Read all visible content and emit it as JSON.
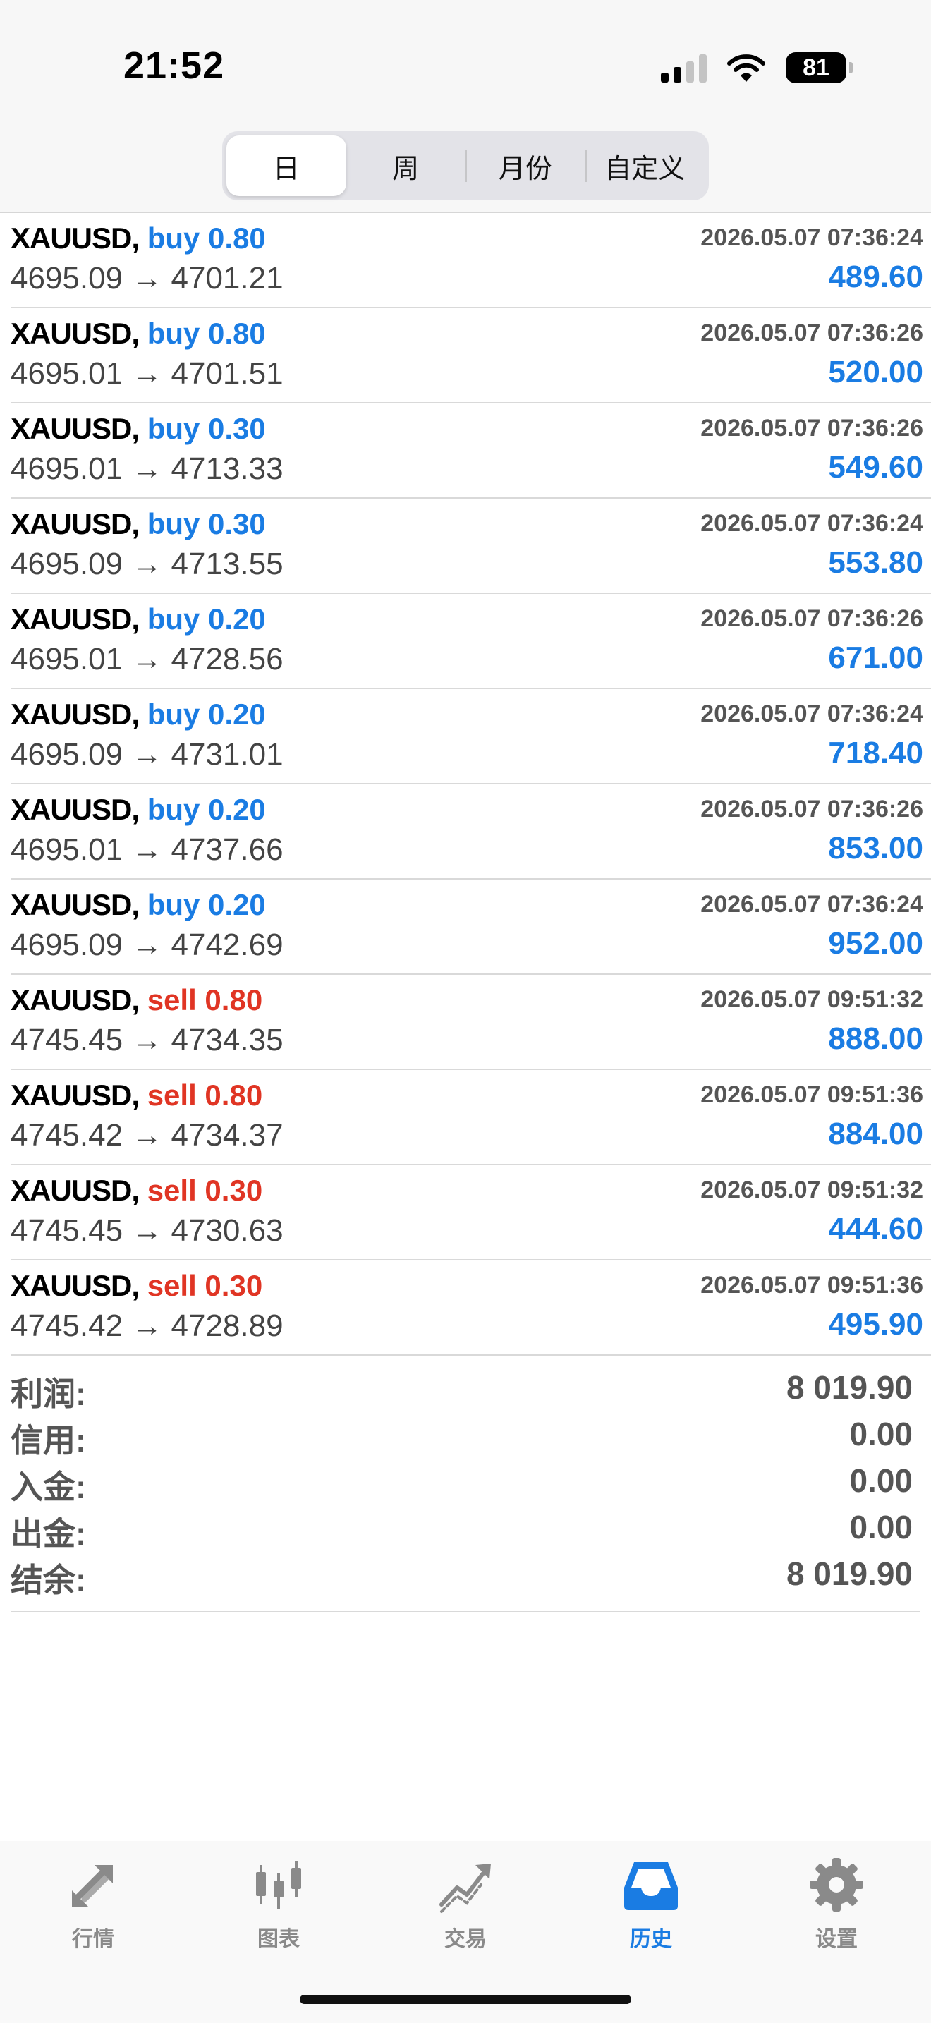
{
  "status_bar": {
    "time": "21:52",
    "battery": "81"
  },
  "period_tabs": [
    {
      "label": "日",
      "active": true
    },
    {
      "label": "周",
      "active": false
    },
    {
      "label": "月份",
      "active": false
    },
    {
      "label": "自定义",
      "active": false
    }
  ],
  "trades": [
    {
      "symbol": "XAUUSD,",
      "side": "buy",
      "side_label": "buy 0.80",
      "prices": "4695.09 → 4701.21",
      "datetime": "2026.05.07 07:36:24",
      "profit": "489.60"
    },
    {
      "symbol": "XAUUSD,",
      "side": "buy",
      "side_label": "buy 0.80",
      "prices": "4695.01 → 4701.51",
      "datetime": "2026.05.07 07:36:26",
      "profit": "520.00"
    },
    {
      "symbol": "XAUUSD,",
      "side": "buy",
      "side_label": "buy 0.30",
      "prices": "4695.01 → 4713.33",
      "datetime": "2026.05.07 07:36:26",
      "profit": "549.60"
    },
    {
      "symbol": "XAUUSD,",
      "side": "buy",
      "side_label": "buy 0.30",
      "prices": "4695.09 → 4713.55",
      "datetime": "2026.05.07 07:36:24",
      "profit": "553.80"
    },
    {
      "symbol": "XAUUSD,",
      "side": "buy",
      "side_label": "buy 0.20",
      "prices": "4695.01 → 4728.56",
      "datetime": "2026.05.07 07:36:26",
      "profit": "671.00"
    },
    {
      "symbol": "XAUUSD,",
      "side": "buy",
      "side_label": "buy 0.20",
      "prices": "4695.09 → 4731.01",
      "datetime": "2026.05.07 07:36:24",
      "profit": "718.40"
    },
    {
      "symbol": "XAUUSD,",
      "side": "buy",
      "side_label": "buy 0.20",
      "prices": "4695.01 → 4737.66",
      "datetime": "2026.05.07 07:36:26",
      "profit": "853.00"
    },
    {
      "symbol": "XAUUSD,",
      "side": "buy",
      "side_label": "buy 0.20",
      "prices": "4695.09 → 4742.69",
      "datetime": "2026.05.07 07:36:24",
      "profit": "952.00"
    },
    {
      "symbol": "XAUUSD,",
      "side": "sell",
      "side_label": "sell 0.80",
      "prices": "4745.45 → 4734.35",
      "datetime": "2026.05.07 09:51:32",
      "profit": "888.00"
    },
    {
      "symbol": "XAUUSD,",
      "side": "sell",
      "side_label": "sell 0.80",
      "prices": "4745.42 → 4734.37",
      "datetime": "2026.05.07 09:51:36",
      "profit": "884.00"
    },
    {
      "symbol": "XAUUSD,",
      "side": "sell",
      "side_label": "sell 0.30",
      "prices": "4745.45 → 4730.63",
      "datetime": "2026.05.07 09:51:32",
      "profit": "444.60"
    },
    {
      "symbol": "XAUUSD,",
      "side": "sell",
      "side_label": "sell 0.30",
      "prices": "4745.42 → 4728.89",
      "datetime": "2026.05.07 09:51:36",
      "profit": "495.90"
    }
  ],
  "summary": [
    {
      "label": "利润:",
      "value": "8 019.90"
    },
    {
      "label": "信用:",
      "value": "0.00"
    },
    {
      "label": "入金:",
      "value": "0.00"
    },
    {
      "label": "出金:",
      "value": "0.00"
    },
    {
      "label": "结余:",
      "value": "8 019.90"
    }
  ],
  "tab_bar": [
    {
      "label": "行情",
      "icon": "quotes-arrows-icon",
      "active": false
    },
    {
      "label": "图表",
      "icon": "candlestick-chart-icon",
      "active": false
    },
    {
      "label": "交易",
      "icon": "trade-trend-icon",
      "active": false
    },
    {
      "label": "历史",
      "icon": "history-inbox-icon",
      "active": true
    },
    {
      "label": "设置",
      "icon": "gear-icon",
      "active": false
    }
  ],
  "colors": {
    "accent": "#1a7ce3",
    "sell": "#e03524",
    "inactive": "#8a8a8a"
  }
}
